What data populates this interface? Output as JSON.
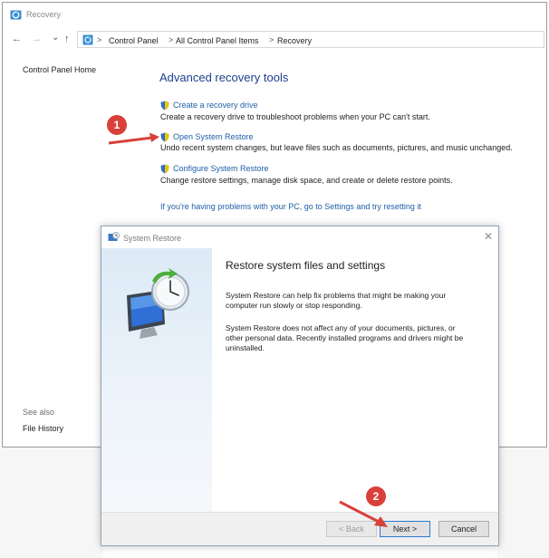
{
  "window": {
    "title": "Recovery"
  },
  "address": {
    "crumbs": [
      "Control Panel",
      "All Control Panel Items",
      "Recovery"
    ],
    "separator": ">"
  },
  "nav": {
    "back": "←",
    "forward": "→",
    "recent": "⌄",
    "up": "↑"
  },
  "sidebar": {
    "home": "Control Panel Home",
    "see_also": "See also",
    "file_history": "File History"
  },
  "main": {
    "heading": "Advanced recovery tools",
    "items": [
      {
        "link": "Create a recovery drive",
        "desc": "Create a recovery drive to troubleshoot problems when your PC can't start."
      },
      {
        "link": "Open System Restore",
        "desc": "Undo recent system changes, but leave files such as documents, pictures, and music unchanged."
      },
      {
        "link": "Configure System Restore",
        "desc": "Change restore settings, manage disk space, and create or delete restore points."
      }
    ],
    "reset_link": "If you're having problems with your PC, go to Settings and try resetting it"
  },
  "callouts": {
    "one": "1",
    "two": "2"
  },
  "dialog": {
    "title": "System Restore",
    "close": "✕",
    "heading": "Restore system files and settings",
    "para1": "System Restore can help fix problems that might be making your computer run slowly or stop responding.",
    "para2": "System Restore does not affect any of your documents, pictures, or other personal data. Recently installed programs and drivers might be uninstalled.",
    "buttons": {
      "back": "< Back",
      "next": "Next >",
      "cancel": "Cancel"
    }
  },
  "colors": {
    "link": "#1f5fa8",
    "heading": "#1f3f8f",
    "callout": "#d9403a",
    "arrow": "#d9403a"
  }
}
